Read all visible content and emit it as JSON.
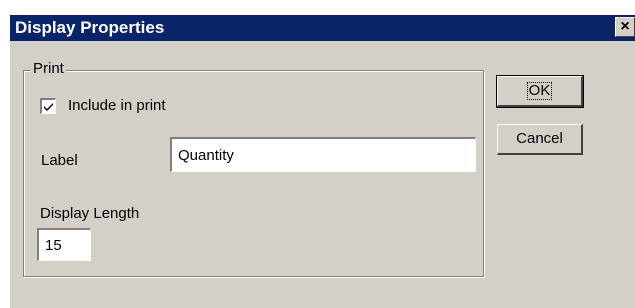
{
  "window": {
    "title": "Display Properties",
    "close_glyph": "×",
    "icons": [
      "close-icon",
      "checkmark-icon"
    ]
  },
  "group": {
    "label": "Print"
  },
  "include_in_print": {
    "label": "Include in print",
    "checked": true
  },
  "label_field": {
    "caption": "Label",
    "value": "Quantity"
  },
  "display_length": {
    "caption": "Display Length",
    "value": "15"
  },
  "buttons": {
    "ok": "OK",
    "cancel": "Cancel"
  }
}
